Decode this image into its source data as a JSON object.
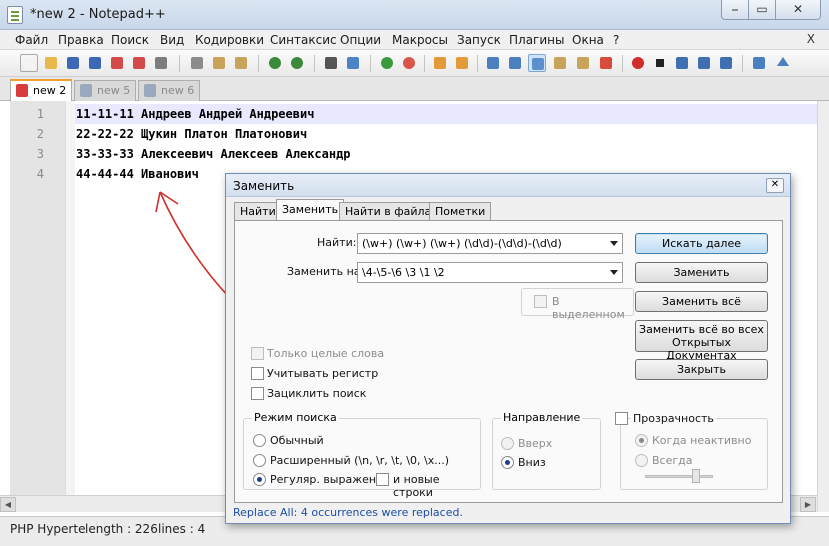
{
  "window": {
    "title": "*new  2 - Notepad++",
    "min_label": "⎯",
    "max_label": "▭",
    "close_label": "✕"
  },
  "menu": {
    "items": [
      "Файл",
      "Правка",
      "Поиск",
      "Вид",
      "Кодировки",
      "Синтаксис",
      "Опции",
      "Макросы",
      "Запуск",
      "Плагины",
      "Окна",
      "?"
    ],
    "close": "X"
  },
  "tabs": [
    {
      "label": "new  2",
      "active": true
    },
    {
      "label": "new  5",
      "active": false
    },
    {
      "label": "new  6",
      "active": false
    }
  ],
  "editor": {
    "lines": [
      {
        "num": "1",
        "text": "11-11-11 Андреев Андрей Андреевич"
      },
      {
        "num": "2",
        "text": "22-22-22 Щукин Платон Платонович"
      },
      {
        "num": "3",
        "text": "33-33-33 Алексеевич Алексеев Александр"
      },
      {
        "num": "4",
        "text": "44-44-44 Иванович"
      }
    ]
  },
  "status": {
    "lang": "PHP Hyperte",
    "length": "length : 226",
    "lines": "lines : 4"
  },
  "dialog": {
    "title": "Заменить",
    "close_label": "✕",
    "tabs": [
      "Найти",
      "Заменить",
      "Найти в файлах",
      "Пометки"
    ],
    "find_label": "Найти:",
    "find_value": "(\\w+) (\\w+) (\\w+) (\\d\\d)-(\\d\\d)-(\\d\\d)",
    "replace_label": "Заменить на:",
    "replace_value": "\\4-\\5-\\6 \\3 \\1 \\2",
    "in_selection": "В выделенном",
    "buttons": {
      "find_next": "Искать далее",
      "replace": "Заменить",
      "replace_all": "Заменить всё",
      "replace_all_docs_1": "Заменить всё во всех",
      "replace_all_docs_2": "Открытых Документах",
      "close": "Закрыть"
    },
    "options": {
      "whole_word": "Только целые слова",
      "match_case": "Учитывать регистр",
      "wrap": "Зациклить поиск"
    },
    "search_mode": {
      "title": "Режим поиска",
      "normal": "Обычный",
      "extended": "Расширенный (\\n, \\r, \\t, \\0, \\x...)",
      "regex": "Регуляр. выражен.",
      "newline": "и новые строки",
      "selected": "regex"
    },
    "direction": {
      "title": "Направление",
      "up": "Вверх",
      "down": "Вниз",
      "selected": "down"
    },
    "transparency": {
      "title": "Прозрачность",
      "inactive": "Когда неактивно",
      "always": "Всегда"
    },
    "status_message": "Replace All: 4 occurrences were replaced."
  },
  "colors": {
    "accent": "#3c7fb1",
    "annotation": "#d0302a",
    "status_text": "#1a4fa8"
  }
}
